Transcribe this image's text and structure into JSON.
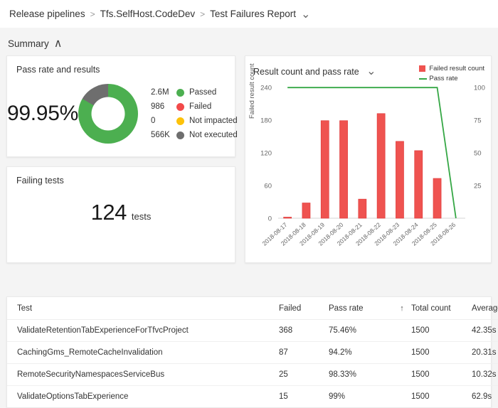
{
  "breadcrumb": {
    "items": [
      {
        "label": "Release pipelines"
      },
      {
        "label": "Tfs.SelfHost.CodeDev"
      },
      {
        "label": "Test Failures Report"
      }
    ],
    "separator": ">",
    "chevron": "⌄"
  },
  "summary": {
    "label": "Summary",
    "chevron": "∧"
  },
  "pass_rate_card": {
    "title": "Pass rate and results",
    "value": "99.95%",
    "legend": [
      {
        "count": "2.6M",
        "label": "Passed",
        "color": "#4caf50"
      },
      {
        "count": "986",
        "label": "Failed",
        "color": "#f24a4a"
      },
      {
        "count": "0",
        "label": "Not impacted",
        "color": "#fdc20a"
      },
      {
        "count": "566K",
        "label": "Not executed",
        "color": "#6e6e6e"
      }
    ]
  },
  "failing_tests_card": {
    "title": "Failing tests",
    "value": "124",
    "unit": "tests"
  },
  "chart_card": {
    "title": "Result count and pass rate",
    "chevron": "⌄",
    "legend": [
      {
        "label": "Failed result count",
        "color": "#ef5350",
        "marker": "square"
      },
      {
        "label": "Pass rate",
        "color": "#35a745",
        "marker": "line"
      }
    ]
  },
  "chart_data": {
    "type": "bar",
    "title": "Result count and pass rate",
    "xlabel": "",
    "ylabel": "Failed result count",
    "y2label": "",
    "categories": [
      "2018-08-17",
      "2018-08-18",
      "2018-08-19",
      "2018-08-20",
      "2018-08-21",
      "2018-08-22",
      "2018-08-23",
      "2018-08-24",
      "2018-08-25",
      "2018-08-26"
    ],
    "series": [
      {
        "name": "Failed result count",
        "type": "bar",
        "axis": "left",
        "color": "#ef5350",
        "values": [
          2,
          28,
          179,
          179,
          35,
          192,
          141,
          124,
          73,
          0
        ]
      },
      {
        "name": "Pass rate",
        "type": "line",
        "axis": "right",
        "color": "#35a745",
        "values": [
          99.9,
          99.9,
          99.9,
          99.9,
          99.9,
          99.9,
          99.9,
          99.9,
          99.9,
          0
        ]
      }
    ],
    "ylim": [
      0,
      240
    ],
    "yticks": [
      0,
      60,
      120,
      180,
      240
    ],
    "y2lim": [
      0,
      100
    ],
    "y2ticks": [
      25,
      50,
      75,
      100
    ],
    "grid": false,
    "legend_position": "top-right"
  },
  "table": {
    "columns": [
      "Test",
      "Failed",
      "Pass rate",
      "Total count",
      "Average duration"
    ],
    "sort_indicator": "↑",
    "rows": [
      {
        "test": "ValidateRetentionTabExperienceForTfvcProject",
        "failed": "368",
        "pass_rate": "75.46%",
        "total": "1500",
        "duration": "42.35s"
      },
      {
        "test": "CachingGms_RemoteCacheInvalidation",
        "failed": "87",
        "pass_rate": "94.2%",
        "total": "1500",
        "duration": "20.31s"
      },
      {
        "test": "RemoteSecurityNamespacesServiceBus",
        "failed": "25",
        "pass_rate": "98.33%",
        "total": "1500",
        "duration": "10.32s"
      },
      {
        "test": "ValidateOptionsTabExperience",
        "failed": "15",
        "pass_rate": "99%",
        "total": "1500",
        "duration": "62.9s"
      }
    ]
  }
}
